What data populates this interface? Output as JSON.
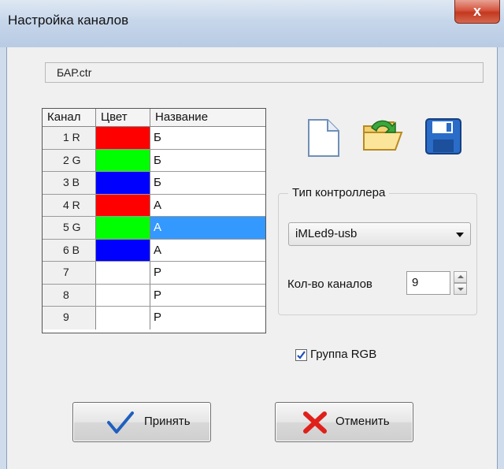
{
  "window": {
    "title": "Настройка каналов",
    "close_label": "x"
  },
  "file": {
    "name": "БАР.ctr"
  },
  "grid": {
    "headers": {
      "channel": "Канал",
      "color": "Цвет",
      "name": "Название"
    },
    "rows": [
      {
        "channel": "1 R",
        "color": "#ff0000",
        "name": "Б"
      },
      {
        "channel": "2 G",
        "color": "#00ff00",
        "name": "Б"
      },
      {
        "channel": "3 B",
        "color": "#0000ff",
        "name": "Б"
      },
      {
        "channel": "4 R",
        "color": "#ff0000",
        "name": "А"
      },
      {
        "channel": "5 G",
        "color": "#00ff00",
        "name": "А",
        "selected": true
      },
      {
        "channel": "6 B",
        "color": "#0000ff",
        "name": "А"
      },
      {
        "channel": "7",
        "color": "#ffffff",
        "name": "Р"
      },
      {
        "channel": "8",
        "color": "#ffffff",
        "name": "Р"
      },
      {
        "channel": "9",
        "color": "#ffffff",
        "name": "Р"
      }
    ]
  },
  "toolbar": {
    "icons": [
      "new-file-icon",
      "open-folder-icon",
      "save-floppy-icon"
    ]
  },
  "controller": {
    "group_label": "Тип контроллера",
    "selected": "iMLed9-usb",
    "count_label": "Кол-во каналов",
    "count_value": "9"
  },
  "rgb_group": {
    "label": "Группа RGB",
    "checked": true
  },
  "buttons": {
    "ok": "Принять",
    "cancel": "Отменить"
  },
  "colors": {
    "selection": "#3399ff",
    "ok_check": "#1f5fbf",
    "cancel_x": "#e0201a"
  }
}
